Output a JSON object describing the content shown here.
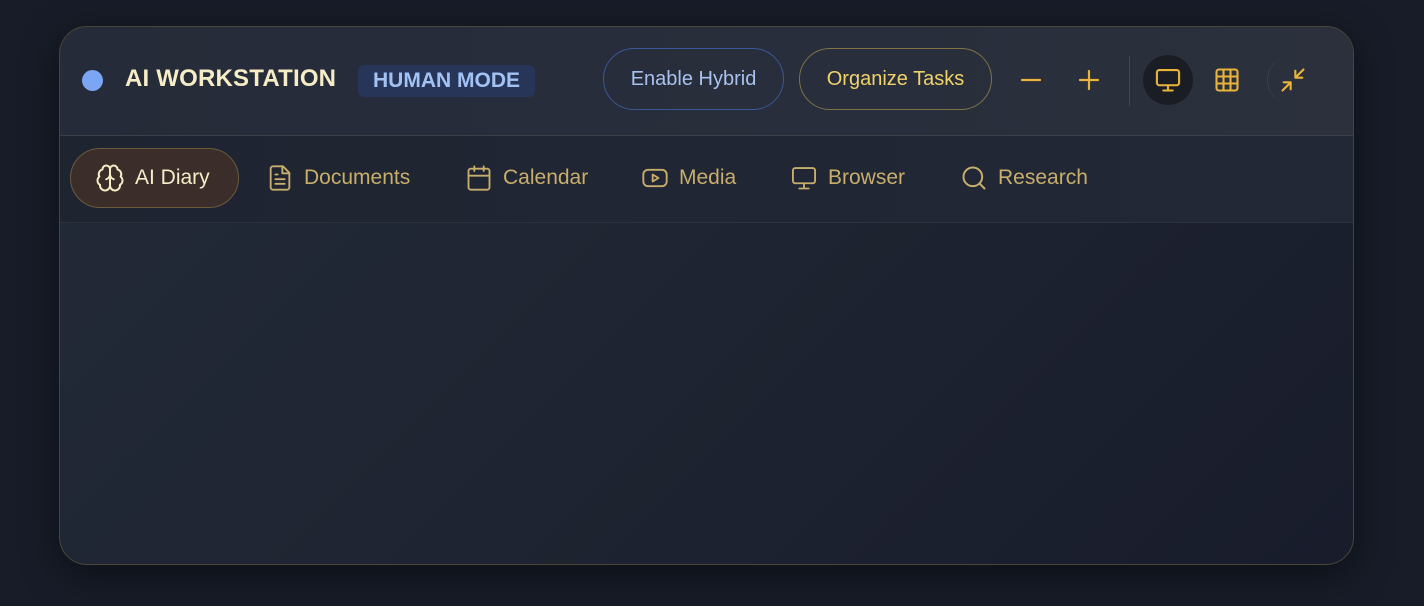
{
  "header": {
    "title": "AI WORKSTATION",
    "mode_badge": "HUMAN MODE",
    "status_dot_color": "#7ba6f4",
    "buttons": {
      "enable_hybrid": "Enable Hybrid",
      "organize_tasks": "Organize Tasks"
    },
    "icons": {
      "zoom_out": "minus-icon",
      "zoom_in": "plus-icon",
      "monitor_view": "monitor-icon",
      "grid_view": "grid-icon",
      "minimize": "minimize-arrows-icon"
    }
  },
  "tabs": [
    {
      "label": "AI Diary",
      "icon": "brain-icon",
      "active": true
    },
    {
      "label": "Documents",
      "icon": "document-icon",
      "active": false
    },
    {
      "label": "Calendar",
      "icon": "calendar-icon",
      "active": false
    },
    {
      "label": "Media",
      "icon": "play-icon",
      "active": false
    },
    {
      "label": "Browser",
      "icon": "monitor-icon",
      "active": false
    },
    {
      "label": "Research",
      "icon": "search-icon",
      "active": false
    }
  ],
  "colors": {
    "accent_gold": "#e8b53a",
    "accent_blue": "#a8c2ef",
    "background": "#171c28"
  }
}
